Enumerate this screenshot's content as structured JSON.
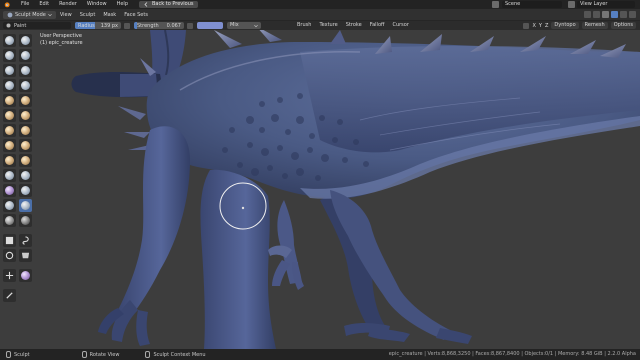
{
  "topbar": {
    "menus": [
      "File",
      "Edit",
      "Render",
      "Window",
      "Help"
    ],
    "back_button": "Back to Previous",
    "scene": "Scene",
    "view_layer": "View Layer"
  },
  "header": {
    "mode": "Sculpt Mode",
    "menus": [
      "View",
      "Sculpt",
      "Mask",
      "Face Sets"
    ]
  },
  "tool_settings": {
    "brush": "Paint",
    "radius_label": "Radius",
    "radius_value": "139 px",
    "strength_label": "Strength",
    "strength_value": "0.067",
    "strength_fraction": 0.067,
    "color": "#7f8fd0",
    "blend_mode": "Mix",
    "dropdowns": [
      "Brush",
      "Texture",
      "Stroke",
      "Falloff",
      "Cursor"
    ],
    "right": {
      "dyntopo": "Dyntopo",
      "remesh": "Remesh",
      "options": "Options"
    }
  },
  "viewport": {
    "perspective": "User Perspective",
    "object": "(1) epic_creature"
  },
  "statusbar": {
    "left": "Sculpt",
    "middle": "Rotate View",
    "context": "Sculpt Context Menu",
    "stats": "epic_creature | Verts:8,868,3250 | Faces:8,867,8400 | Objects:0/1 | Memory: 8.48 GiB | 2.2.0 Alpha"
  },
  "colors": {
    "creature": "#4a5a84",
    "accent": "#5680c2",
    "background": "#3d3d3d"
  }
}
